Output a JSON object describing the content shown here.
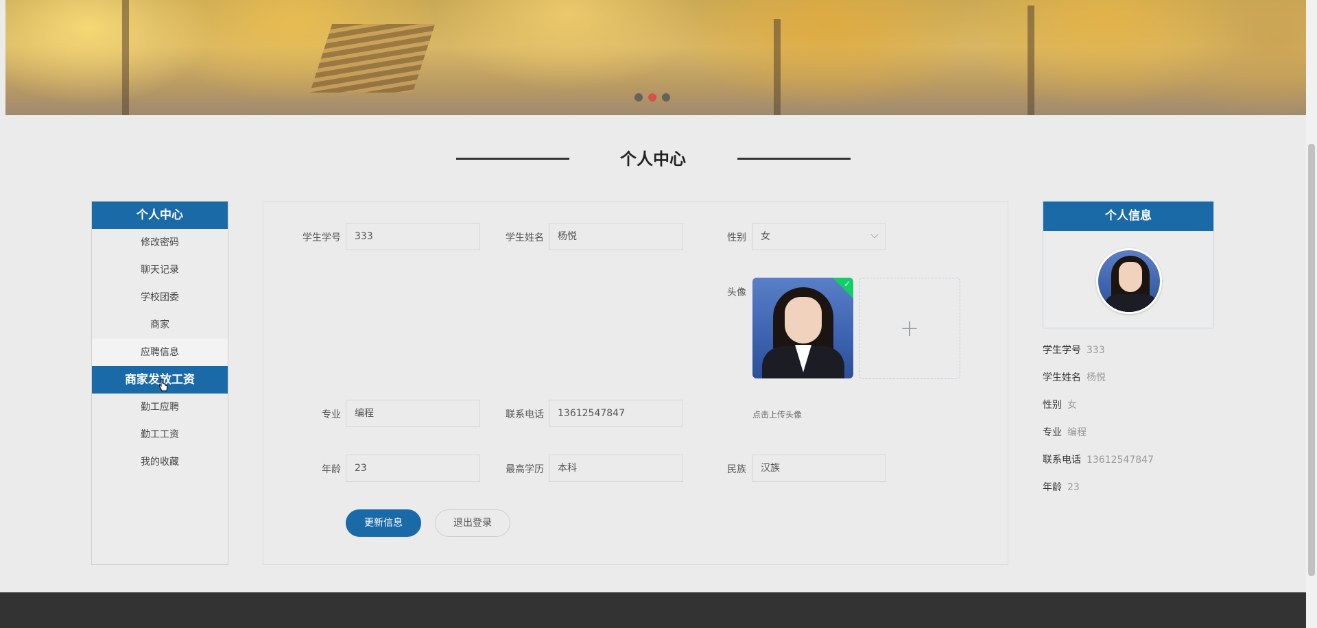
{
  "banner": {
    "carousel_dots": 3,
    "active_dot": 2
  },
  "page_title": "个人中心",
  "left_menu": {
    "header": "个人中心",
    "items": [
      {
        "label": "修改密码"
      },
      {
        "label": "聊天记录"
      },
      {
        "label": "学校团委"
      },
      {
        "label": "商家"
      },
      {
        "label": "应聘信息"
      },
      {
        "label": "商家发放工资"
      },
      {
        "label": "勤工应聘"
      },
      {
        "label": "勤工工资"
      },
      {
        "label": "我的收藏"
      }
    ]
  },
  "form": {
    "student_no": {
      "label": "学生学号",
      "value": "333"
    },
    "student_name": {
      "label": "学生姓名",
      "value": "杨悦"
    },
    "gender": {
      "label": "性别",
      "value": "女"
    },
    "avatar": {
      "label": "头像",
      "upload_tip": "点击上传头像",
      "plus": "+",
      "check": "✓"
    },
    "major": {
      "label": "专业",
      "value": "编程"
    },
    "phone": {
      "label": "联系电话",
      "value": "13612547847"
    },
    "age": {
      "label": "年龄",
      "value": "23"
    },
    "education": {
      "label": "最高学历",
      "value": "本科"
    },
    "ethnicity": {
      "label": "民族",
      "value": "汉族"
    },
    "update_button": "更新信息",
    "logout_button": "退出登录"
  },
  "info_panel": {
    "title": "个人信息",
    "rows": [
      {
        "k": "学生学号",
        "v": "333"
      },
      {
        "k": "学生姓名",
        "v": "杨悦"
      },
      {
        "k": "性别",
        "v": "女"
      },
      {
        "k": "专业",
        "v": "编程"
      },
      {
        "k": "联系电话",
        "v": "13612547847"
      },
      {
        "k": "年龄",
        "v": "23"
      }
    ]
  },
  "colors": {
    "primary": "#1a6aa8",
    "active_dot": "#e04040",
    "success": "#13ce66"
  }
}
